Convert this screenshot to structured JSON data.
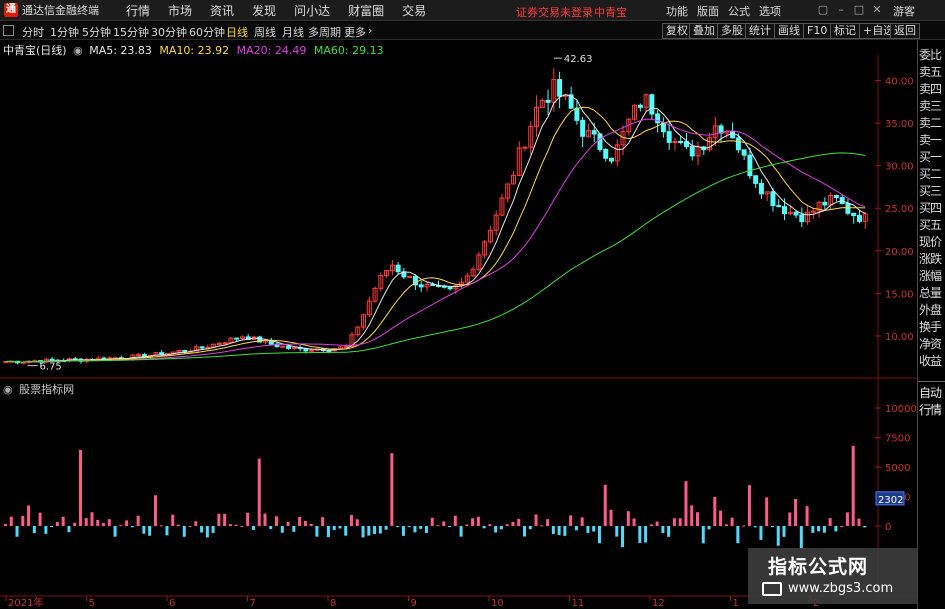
{
  "app": {
    "logo_char": "通",
    "title": "通达信金融终端",
    "menus": [
      "行情",
      "市场",
      "资讯",
      "发现",
      "问小达",
      "财富圈",
      "交易"
    ],
    "login_warning": "证券交易未登录",
    "stock_tag": "中青宝",
    "right_menus": [
      "功能",
      "版面",
      "公式",
      "选项"
    ],
    "guest": "游客"
  },
  "toolbar": {
    "periods": [
      "分时",
      "1分钟",
      "5分钟",
      "15分钟",
      "30分钟",
      "60分钟",
      "日线",
      "周线",
      "月线",
      "多周期",
      "更多"
    ],
    "active_period": "日线",
    "buttons": [
      "复权",
      "叠加",
      "多股",
      "统计",
      "画线",
      "F10",
      "标记",
      "+自选",
      "返回"
    ]
  },
  "main_chart": {
    "title": "中青宝(日线)",
    "indicators": [
      {
        "label": "MA5: 23.83",
        "color": "#e8e8e8"
      },
      {
        "label": "MA10: 23.92",
        "color": "#ffd94a"
      },
      {
        "label": "MA20: 24.49",
        "color": "#e040e0"
      },
      {
        "label": "MA60: 29.13",
        "color": "#40e040"
      }
    ],
    "max_label": "42.63",
    "min_label": "6.75"
  },
  "sub_chart": {
    "title": "股票指标网",
    "current_value": "2302"
  },
  "right_panel": {
    "items": [
      "委比",
      "卖五",
      "卖四",
      "卖三",
      "卖二",
      "卖一",
      "买一",
      "买二",
      "买三",
      "买四",
      "买五",
      "现价",
      "涨跌",
      "涨幅",
      "总量",
      "外盘",
      "换手",
      "净资",
      "收益"
    ],
    "bottom_items": [
      "自动",
      "行情"
    ]
  },
  "watermark": {
    "title": "指标公式网",
    "url": "www.zbgs3.com"
  },
  "chart_data": [
    {
      "type": "candlestick",
      "title": "中青宝(日线)",
      "y_ticks": [
        10.0,
        15.0,
        20.0,
        25.0,
        30.0,
        35.0,
        40.0
      ],
      "ylim": [
        6,
        43
      ],
      "x_labels": [
        "2021年",
        "5",
        "6",
        "7",
        "8",
        "9",
        "10",
        "11",
        "12",
        "1",
        "2"
      ],
      "approx_close": [
        7.0,
        7.0,
        7.1,
        7.1,
        7.2,
        7.2,
        7.3,
        7.4,
        7.5,
        7.6,
        7.8,
        8.0,
        8.3,
        8.5,
        9.0,
        9.5,
        10.0,
        9.5,
        9.0,
        8.6,
        8.4,
        8.5,
        8.5,
        8.7,
        12.0,
        16.0,
        18.5,
        17.0,
        16.0,
        15.5,
        15.2,
        16.5,
        20.0,
        24.0,
        28.0,
        33.0,
        37.5,
        39.0,
        37.0,
        34.0,
        32.5,
        31.0,
        35.0,
        38.0,
        36.0,
        33.0,
        31.5,
        32.5,
        35.0,
        34.0,
        30.0,
        27.5,
        25.5,
        24.5,
        24.0,
        25.5,
        26.0,
        24.5,
        23.8
      ],
      "series": [
        {
          "name": "MA5",
          "last": 23.83
        },
        {
          "name": "MA10",
          "last": 23.92
        },
        {
          "name": "MA20",
          "last": 24.49
        },
        {
          "name": "MA60",
          "last": 29.13
        }
      ],
      "max_point": 42.63,
      "min_point": 6.75
    },
    {
      "type": "bar",
      "title": "股票指标网",
      "y_ticks": [
        0,
        2500,
        5000,
        7500,
        10000
      ],
      "last_value": 2302
    }
  ]
}
